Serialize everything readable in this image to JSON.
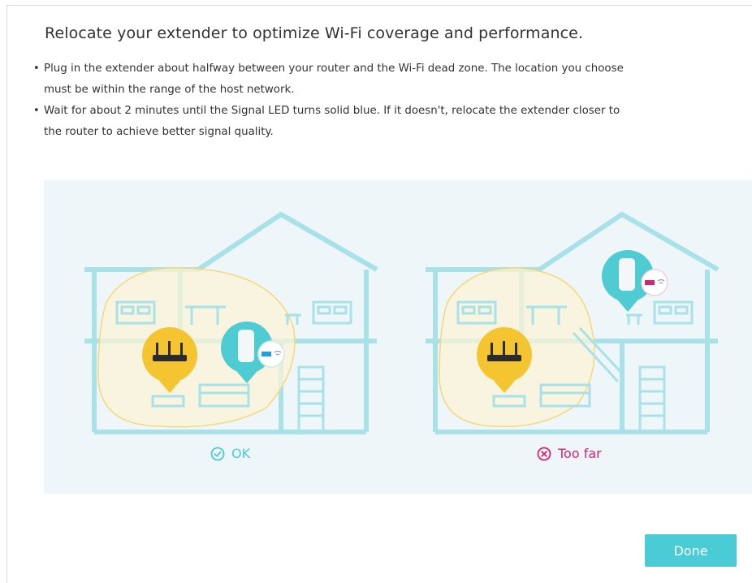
{
  "page": {
    "title": "Relocate your extender to optimize Wi-Fi coverage and performance.",
    "instructions": [
      {
        "line1": "Plug in the extender about halfway between your router and the Wi-Fi dead zone. The location you choose",
        "line2": "must be within the range of the host network."
      },
      {
        "line1": "Wait for about 2 minutes until the Signal LED turns solid blue. If it doesn't, relocate the extender closer to",
        "line2": "the router to achieve better signal quality."
      }
    ],
    "bullet_glyph": "•"
  },
  "illustrations": {
    "ok": {
      "label": "OK",
      "icon": "check-circle-icon",
      "color": "#4acbd6"
    },
    "too_far": {
      "label": "Too far",
      "icon": "x-circle-icon",
      "color": "#d6246e"
    }
  },
  "actions": {
    "done_label": "Done"
  },
  "colors": {
    "accent": "#4acbd6",
    "error": "#d6246e",
    "house_outline": "#a8e2e8",
    "coverage_fill": "#fbf3d6",
    "coverage_stroke": "#f5d87a",
    "router_badge": "#f5c531",
    "panel_bg": "#eef6f9"
  }
}
